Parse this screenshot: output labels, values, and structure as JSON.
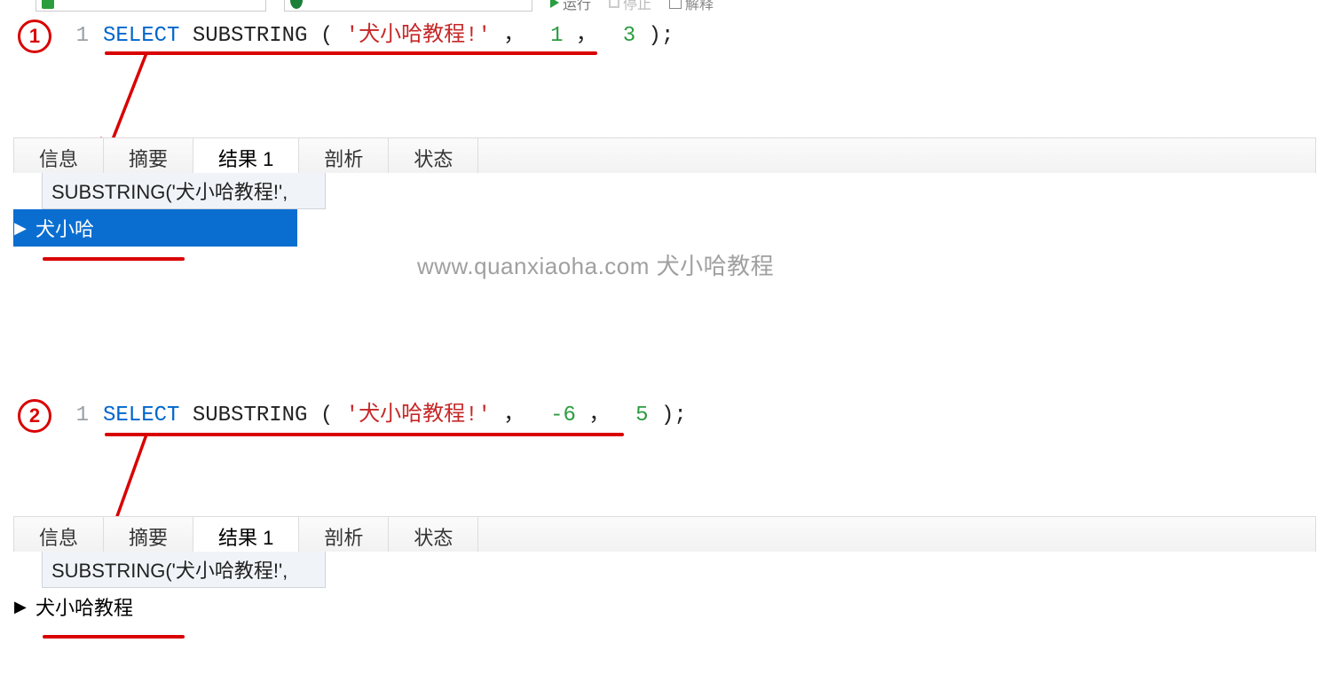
{
  "toolbar": {
    "run_label": "运行",
    "stop_label": "停止",
    "explain_label": "解释"
  },
  "badge1": "1",
  "badge2": "2",
  "editor1": {
    "lineno": "1",
    "select_kw": "SELECT",
    "func": " SUBSTRING",
    "open": "(",
    "str": "'犬小哈教程!'",
    "comma1": "，",
    "arg1": "1",
    "comma2": "，",
    "arg2": "3",
    "close": ");"
  },
  "editor2": {
    "lineno": "1",
    "select_kw": "SELECT",
    "func": " SUBSTRING",
    "open": "(",
    "str": "'犬小哈教程!'",
    "comma1": "，",
    "arg1": "-6",
    "comma2": "，",
    "arg2": "5",
    "close": ");"
  },
  "tabs": {
    "info": "信息",
    "summary": "摘要",
    "result": "结果 1",
    "profile": "剖析",
    "status": "状态"
  },
  "result1": {
    "header": "SUBSTRING('犬小哈教程!',",
    "value": "犬小哈"
  },
  "result2": {
    "header": "SUBSTRING('犬小哈教程!',",
    "value": "犬小哈教程"
  },
  "watermark": "www.quanxiaoha.com 犬小哈教程"
}
